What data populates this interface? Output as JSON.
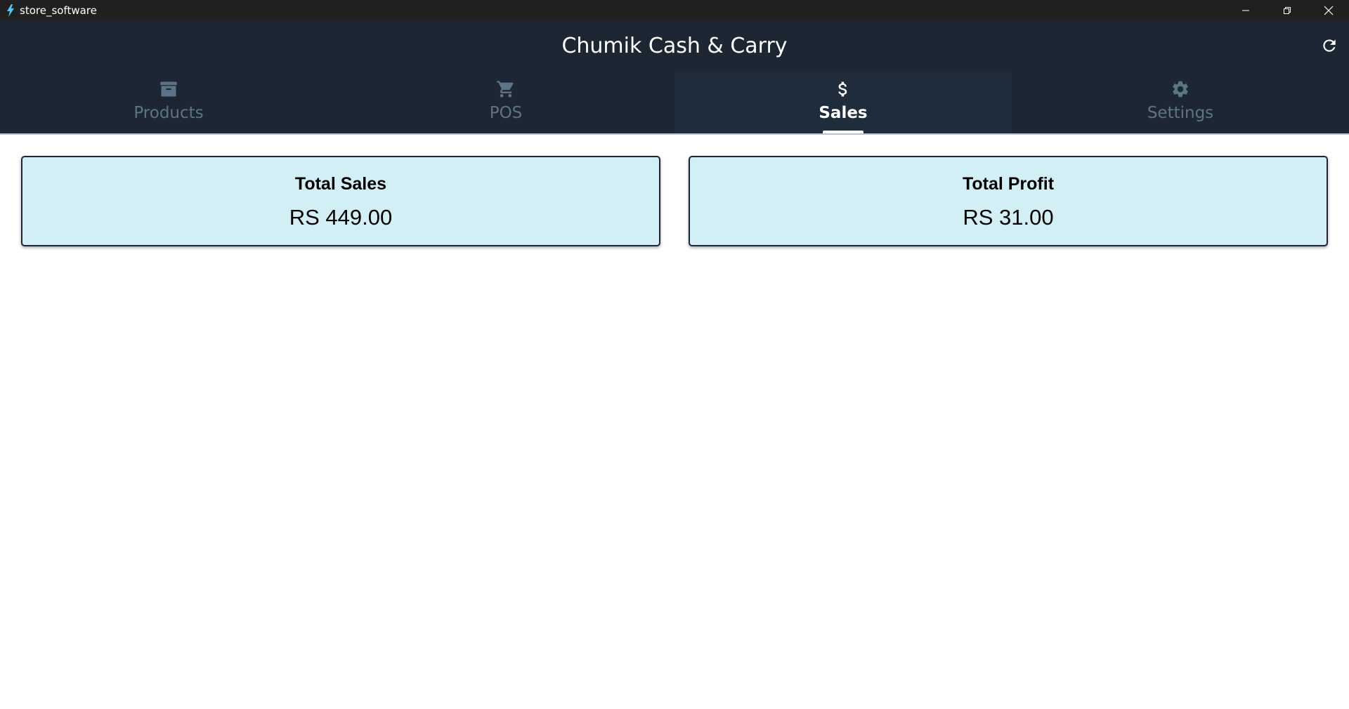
{
  "window": {
    "title": "store_software",
    "icon": "flutter-bolt-icon"
  },
  "header": {
    "title": "Chumik Cash & Carry",
    "refresh_icon": "refresh-icon"
  },
  "tabs": [
    {
      "label": "Products",
      "icon": "archive-box-icon",
      "active": false
    },
    {
      "label": "POS",
      "icon": "cart-icon",
      "active": false
    },
    {
      "label": "Sales",
      "icon": "dollar-icon",
      "active": true
    },
    {
      "label": "Settings",
      "icon": "gear-icon",
      "active": false
    }
  ],
  "summary": {
    "total_sales": {
      "label": "Total Sales",
      "value": "RS 449.00"
    },
    "total_profit": {
      "label": "Total Profit",
      "value": "RS 31.00"
    }
  },
  "colors": {
    "titlebar": "#202020",
    "header": "#1c2733",
    "tab_inactive": "#5c7486",
    "tab_active_bg": "#1e2c3b",
    "card_bg": "#d2eff5"
  }
}
